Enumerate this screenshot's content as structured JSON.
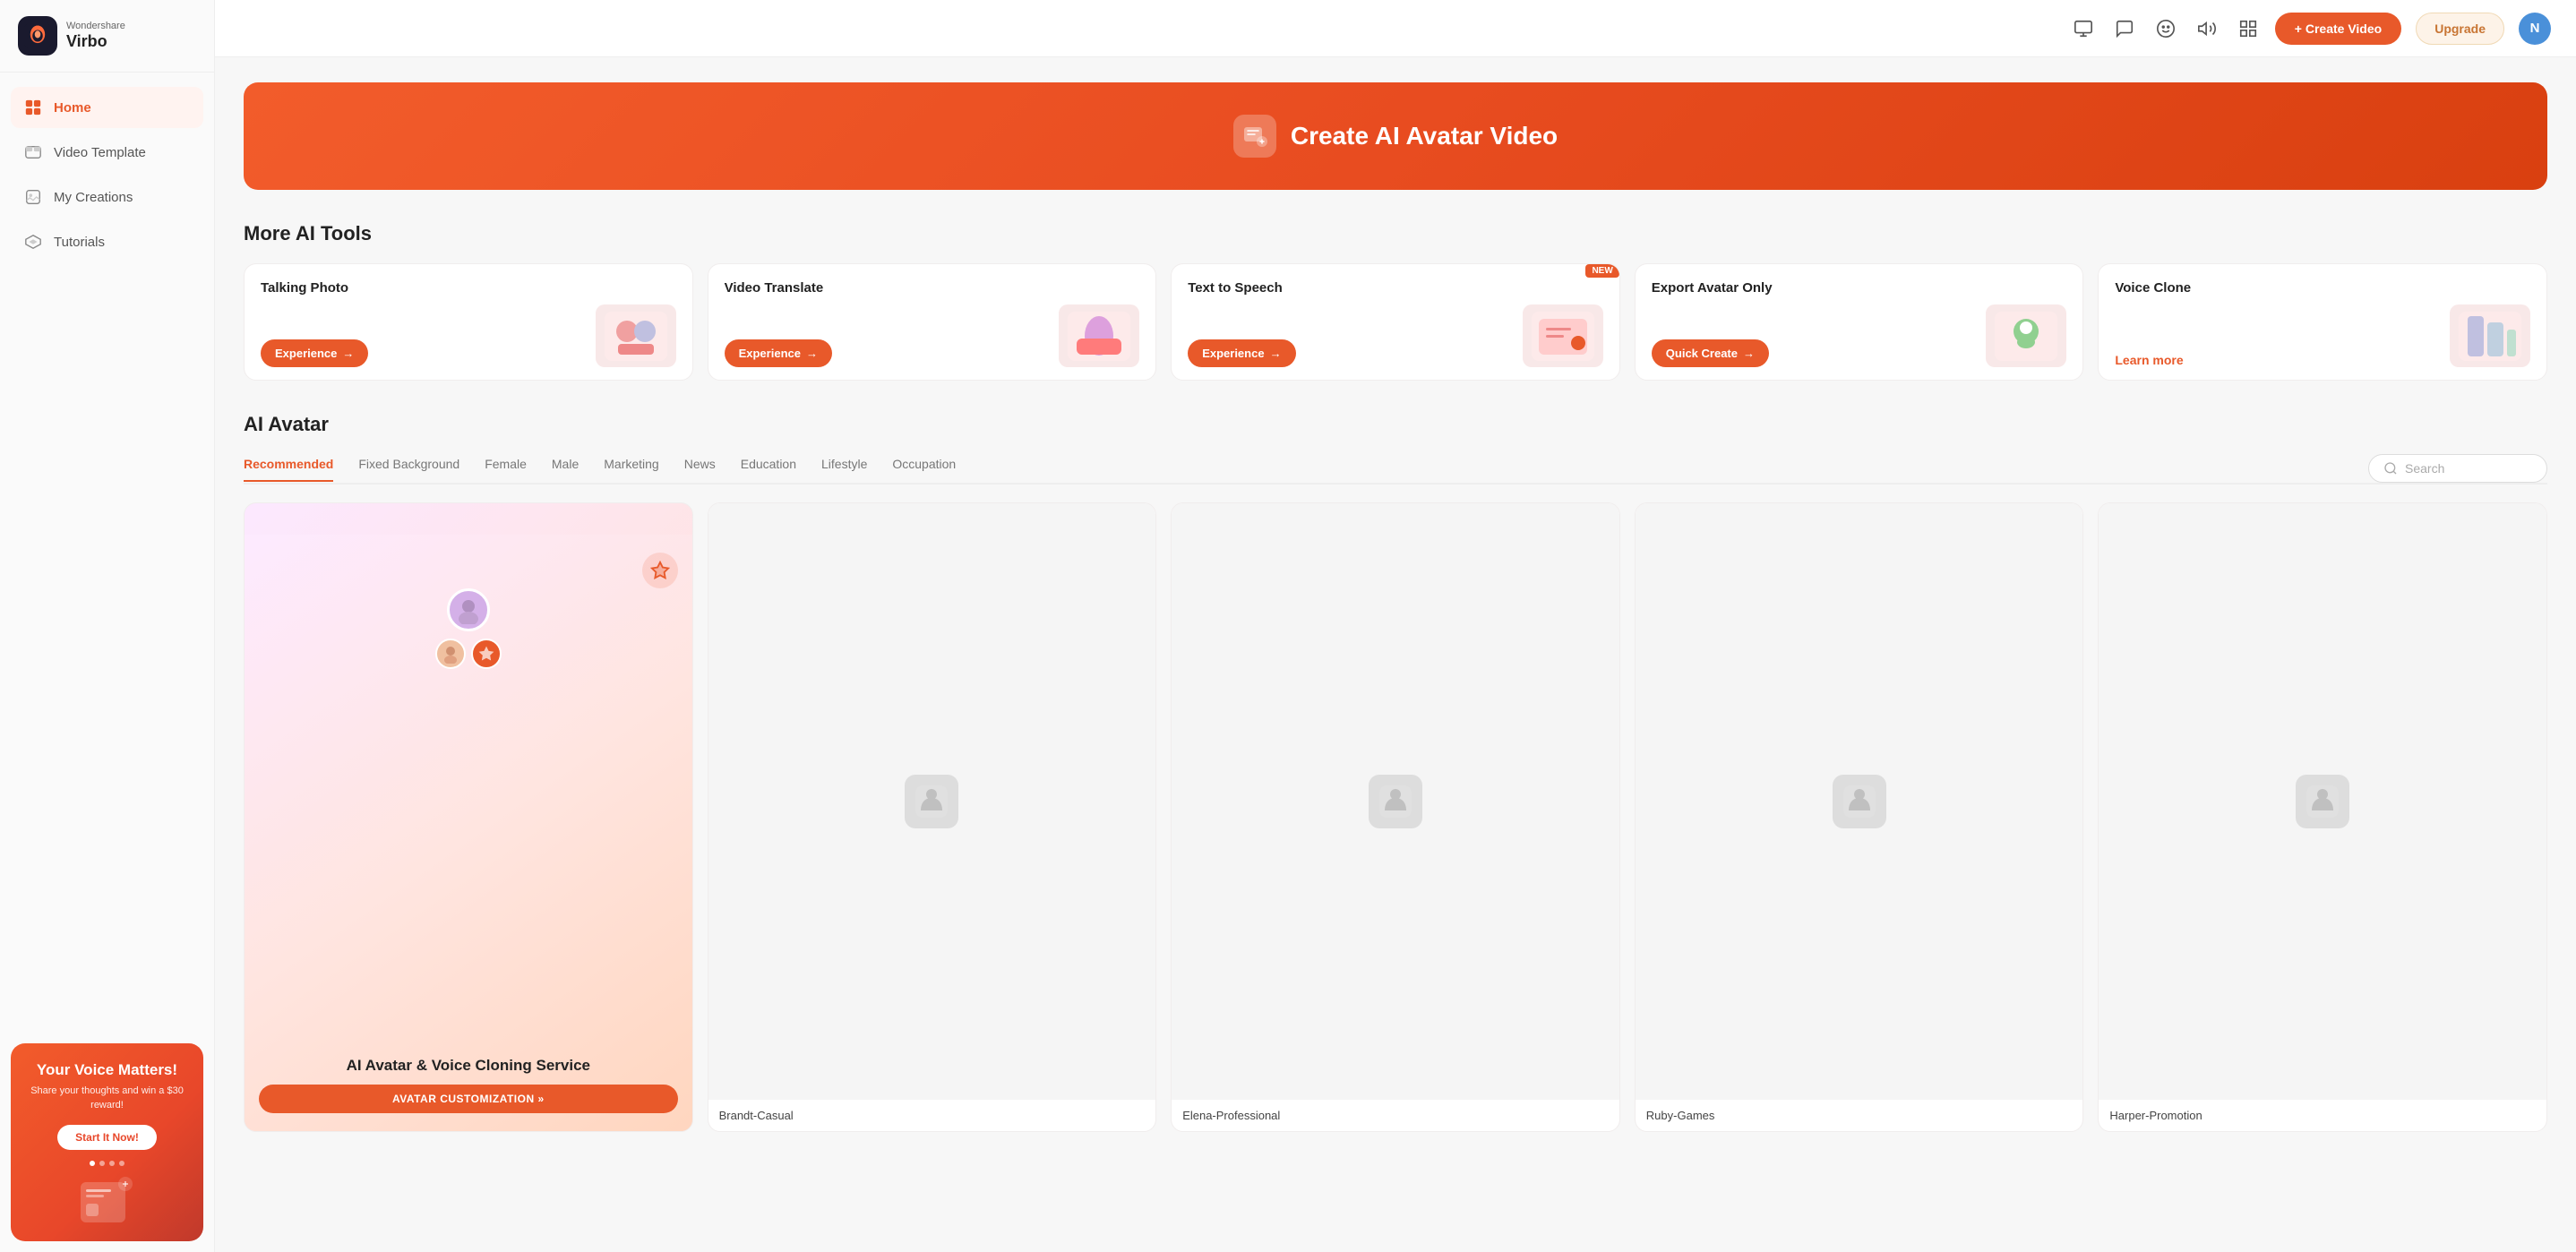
{
  "app": {
    "brand": "Wondershare",
    "name": "Virbo"
  },
  "sidebar": {
    "nav_items": [
      {
        "id": "home",
        "label": "Home",
        "active": true
      },
      {
        "id": "video-template",
        "label": "Video Template",
        "active": false
      },
      {
        "id": "my-creations",
        "label": "My Creations",
        "active": false
      },
      {
        "id": "tutorials",
        "label": "Tutorials",
        "active": false
      }
    ],
    "promo": {
      "title": "Your Voice Matters!",
      "subtitle": "Share your thoughts and win a $30 reward!",
      "button_label": "Start It Now!"
    }
  },
  "topbar": {
    "create_button": "+ Create Video",
    "upgrade_button": "Upgrade",
    "user_initial": "N"
  },
  "hero": {
    "title": "Create AI Avatar Video"
  },
  "more_ai_tools": {
    "section_title": "More AI Tools",
    "tools": [
      {
        "id": "talking-photo",
        "name": "Talking Photo",
        "button": "Experience",
        "has_new": false
      },
      {
        "id": "video-translate",
        "name": "Video Translate",
        "button": "Experience",
        "has_new": false
      },
      {
        "id": "text-to-speech",
        "name": "Text to Speech",
        "button": "Experience",
        "has_new": true
      },
      {
        "id": "export-avatar",
        "name": "Export Avatar Only",
        "button": "Quick Create",
        "has_new": false
      },
      {
        "id": "voice-clone",
        "name": "Voice Clone",
        "button": "Learn more",
        "has_new": false,
        "is_link": true
      }
    ]
  },
  "ai_avatar": {
    "section_title": "AI Avatar",
    "filters": [
      {
        "id": "recommended",
        "label": "Recommended",
        "active": true
      },
      {
        "id": "fixed-bg",
        "label": "Fixed Background",
        "active": false
      },
      {
        "id": "female",
        "label": "Female",
        "active": false
      },
      {
        "id": "male",
        "label": "Male",
        "active": false
      },
      {
        "id": "marketing",
        "label": "Marketing",
        "active": false
      },
      {
        "id": "news",
        "label": "News",
        "active": false
      },
      {
        "id": "education",
        "label": "Education",
        "active": false
      },
      {
        "id": "lifestyle",
        "label": "Lifestyle",
        "active": false
      },
      {
        "id": "occupation",
        "label": "Occupation",
        "active": false
      }
    ],
    "search_placeholder": "Search",
    "promo_card": {
      "title": "AI Avatar & Voice Cloning Service",
      "button_label": "AVATAR CUSTOMIZATION »"
    },
    "avatars": [
      {
        "id": "brandt",
        "label": "Brandt-Casual"
      },
      {
        "id": "elena",
        "label": "Elena-Professional"
      },
      {
        "id": "ruby",
        "label": "Ruby-Games"
      },
      {
        "id": "harper",
        "label": "Harper-Promotion"
      }
    ]
  },
  "icons": {
    "home": "🏠",
    "video_template": "📋",
    "my_creations": "🎨",
    "tutorials": "🎓",
    "search": "🔍",
    "plus": "+",
    "arrow_right": "→"
  },
  "colors": {
    "primary": "#e8592a",
    "primary_light": "#fff3f0",
    "bg": "#f7f7f7",
    "sidebar_bg": "#fafafa"
  }
}
